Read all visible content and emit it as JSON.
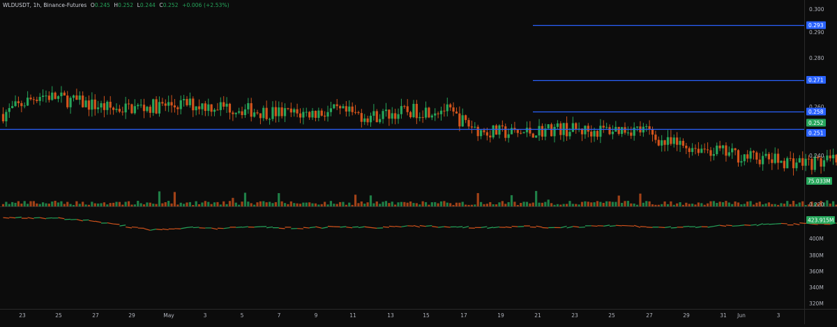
{
  "legend": {
    "symbol": "WLDUSDT, 1h, Binance-Futures",
    "o_label": "O",
    "o_val": "0.245",
    "h_label": "H",
    "h_val": "0.252",
    "l_label": "L",
    "l_val": "0.244",
    "c_label": "C",
    "c_val": "0.252",
    "change": "+0.006 (+2.53%)"
  },
  "colors": {
    "up": "#26a65b",
    "down": "#d4541c",
    "line": "#2962ff",
    "bg": "#0c0c0c",
    "grid": "#1e1e1e"
  },
  "chart_data": [
    {
      "type": "candlestick",
      "title": "",
      "symbol": "WLDUSDT",
      "interval": "1h",
      "exchange": "Binance-Futures",
      "ylim": [
        0.218,
        0.303
      ],
      "y_ticks": [
        "0.300",
        "0.290",
        "0.280",
        "0.260",
        "0.240",
        "0.220"
      ],
      "x_ticks": [
        "23",
        "25",
        "27",
        "29",
        "May",
        "3",
        "5",
        "7",
        "9",
        "11",
        "13",
        "15",
        "17",
        "19",
        "21",
        "23",
        "25",
        "27",
        "29",
        "31",
        "Jun",
        "3"
      ],
      "close_path": [
        [
          0,
          0.257
        ],
        [
          2,
          0.265
        ],
        [
          4,
          0.262
        ],
        [
          6,
          0.259
        ],
        [
          8,
          0.26
        ],
        [
          10,
          0.261
        ],
        [
          12,
          0.26
        ],
        [
          14,
          0.258
        ],
        [
          16,
          0.257
        ],
        [
          18,
          0.258
        ],
        [
          20,
          0.256
        ],
        [
          22,
          0.258
        ],
        [
          24,
          0.259
        ],
        [
          25,
          0.254
        ],
        [
          26,
          0.25
        ],
        [
          28,
          0.249
        ],
        [
          30,
          0.251
        ],
        [
          32,
          0.25
        ],
        [
          34,
          0.251
        ],
        [
          35,
          0.25
        ],
        [
          36,
          0.245
        ],
        [
          38,
          0.243
        ],
        [
          40,
          0.24
        ],
        [
          42,
          0.238
        ],
        [
          44,
          0.237
        ],
        [
          46,
          0.238
        ],
        [
          48,
          0.236
        ],
        [
          50,
          0.237
        ],
        [
          52,
          0.238
        ],
        [
          54,
          0.239
        ],
        [
          56,
          0.237
        ],
        [
          58,
          0.24
        ],
        [
          60,
          0.24
        ],
        [
          62,
          0.244
        ],
        [
          64,
          0.249
        ],
        [
          66,
          0.255
        ],
        [
          68,
          0.253
        ],
        [
          70,
          0.256
        ],
        [
          72,
          0.253
        ],
        [
          74,
          0.249
        ],
        [
          76,
          0.252
        ],
        [
          78,
          0.255
        ],
        [
          80,
          0.262
        ],
        [
          82,
          0.271
        ],
        [
          84,
          0.275
        ],
        [
          86,
          0.276
        ],
        [
          88,
          0.272
        ],
        [
          90,
          0.273
        ],
        [
          92,
          0.271
        ],
        [
          94,
          0.277
        ],
        [
          96,
          0.283
        ],
        [
          97,
          0.291
        ],
        [
          98,
          0.285
        ],
        [
          100,
          0.281
        ],
        [
          102,
          0.283
        ],
        [
          104,
          0.284
        ],
        [
          106,
          0.281
        ],
        [
          108,
          0.275
        ],
        [
          110,
          0.268
        ],
        [
          112,
          0.279
        ],
        [
          113,
          0.286
        ],
        [
          114,
          0.279
        ],
        [
          116,
          0.264
        ],
        [
          118,
          0.259
        ],
        [
          120,
          0.258
        ],
        [
          122,
          0.261
        ],
        [
          124,
          0.265
        ],
        [
          126,
          0.267
        ],
        [
          127,
          0.272
        ],
        [
          128,
          0.266
        ],
        [
          129,
          0.252
        ],
        [
          130,
          0.245
        ],
        [
          132,
          0.244
        ],
        [
          134,
          0.242
        ],
        [
          136,
          0.241
        ],
        [
          138,
          0.244
        ],
        [
          140,
          0.243
        ],
        [
          142,
          0.237
        ],
        [
          143,
          0.236
        ],
        [
          144,
          0.239
        ],
        [
          146,
          0.249
        ],
        [
          148,
          0.242
        ],
        [
          150,
          0.241
        ],
        [
          151,
          0.242
        ],
        [
          152,
          0.237
        ],
        [
          153,
          0.243
        ],
        [
          154,
          0.252
        ]
      ],
      "price_lines": [
        0.293,
        0.271,
        0.258,
        0.251
      ],
      "price_line_labels": [
        "0.293",
        "0.271",
        "0.258",
        "0.251"
      ],
      "last_price": "0.252",
      "volume": {
        "last_value": "75.033M"
      }
    },
    {
      "type": "line",
      "title": "",
      "ylim": [
        315,
        432
      ],
      "y_ticks": [
        "420M",
        "400M",
        "380M",
        "360M",
        "340M",
        "320M"
      ],
      "last_value": "423.915M",
      "series": [
        {
          "name": "",
          "points": [
            [
              0,
              423
            ],
            [
              2,
              423
            ],
            [
              4,
              421
            ],
            [
              6,
              416
            ],
            [
              8,
              409
            ],
            [
              10,
              412
            ],
            [
              12,
              411
            ],
            [
              14,
              413
            ],
            [
              16,
              411
            ],
            [
              18,
              413
            ],
            [
              20,
              412
            ],
            [
              22,
              414
            ],
            [
              24,
              413
            ],
            [
              26,
              412
            ],
            [
              28,
              413
            ],
            [
              30,
              412
            ],
            [
              32,
              414
            ],
            [
              34,
              414
            ],
            [
              36,
              412
            ],
            [
              38,
              413
            ],
            [
              40,
              414
            ],
            [
              42,
              416
            ],
            [
              44,
              416
            ],
            [
              46,
              417
            ],
            [
              48,
              418
            ],
            [
              50,
              419
            ],
            [
              52,
              420
            ],
            [
              54,
              421
            ],
            [
              56,
              421
            ],
            [
              58,
              419
            ],
            [
              60,
              418
            ],
            [
              62,
              417
            ],
            [
              64,
              416
            ],
            [
              66,
              417
            ],
            [
              68,
              418
            ],
            [
              70,
              419
            ],
            [
              72,
              418
            ],
            [
              74,
              412
            ],
            [
              76,
              405
            ],
            [
              78,
              398
            ],
            [
              80,
              391
            ],
            [
              82,
              385
            ],
            [
              84,
              383
            ],
            [
              86,
              382
            ],
            [
              88,
              380
            ],
            [
              90,
              377
            ],
            [
              92,
              375
            ],
            [
              94,
              373
            ],
            [
              96,
              370
            ],
            [
              97,
              371
            ],
            [
              98,
              391
            ],
            [
              99,
              396
            ],
            [
              100,
              385
            ],
            [
              102,
              386
            ],
            [
              104,
              384
            ],
            [
              106,
              378
            ],
            [
              108,
              372
            ],
            [
              110,
              353
            ],
            [
              112,
              343
            ],
            [
              114,
              338
            ],
            [
              116,
              337
            ],
            [
              118,
              338
            ],
            [
              120,
              339
            ],
            [
              122,
              338
            ],
            [
              124,
              340
            ],
            [
              126,
              336
            ],
            [
              127,
              331
            ],
            [
              128,
              326
            ],
            [
              129,
              324
            ],
            [
              130,
              340
            ],
            [
              132,
              352
            ],
            [
              134,
              368
            ],
            [
              136,
              371
            ],
            [
              138,
              376
            ],
            [
              140,
              378
            ],
            [
              142,
              377
            ],
            [
              143,
              373
            ],
            [
              144,
              379
            ],
            [
              146,
              384
            ],
            [
              148,
              387
            ],
            [
              150,
              390
            ],
            [
              151,
              388
            ],
            [
              152,
              395
            ],
            [
              153,
              410
            ],
            [
              154,
              424
            ]
          ]
        }
      ]
    }
  ]
}
